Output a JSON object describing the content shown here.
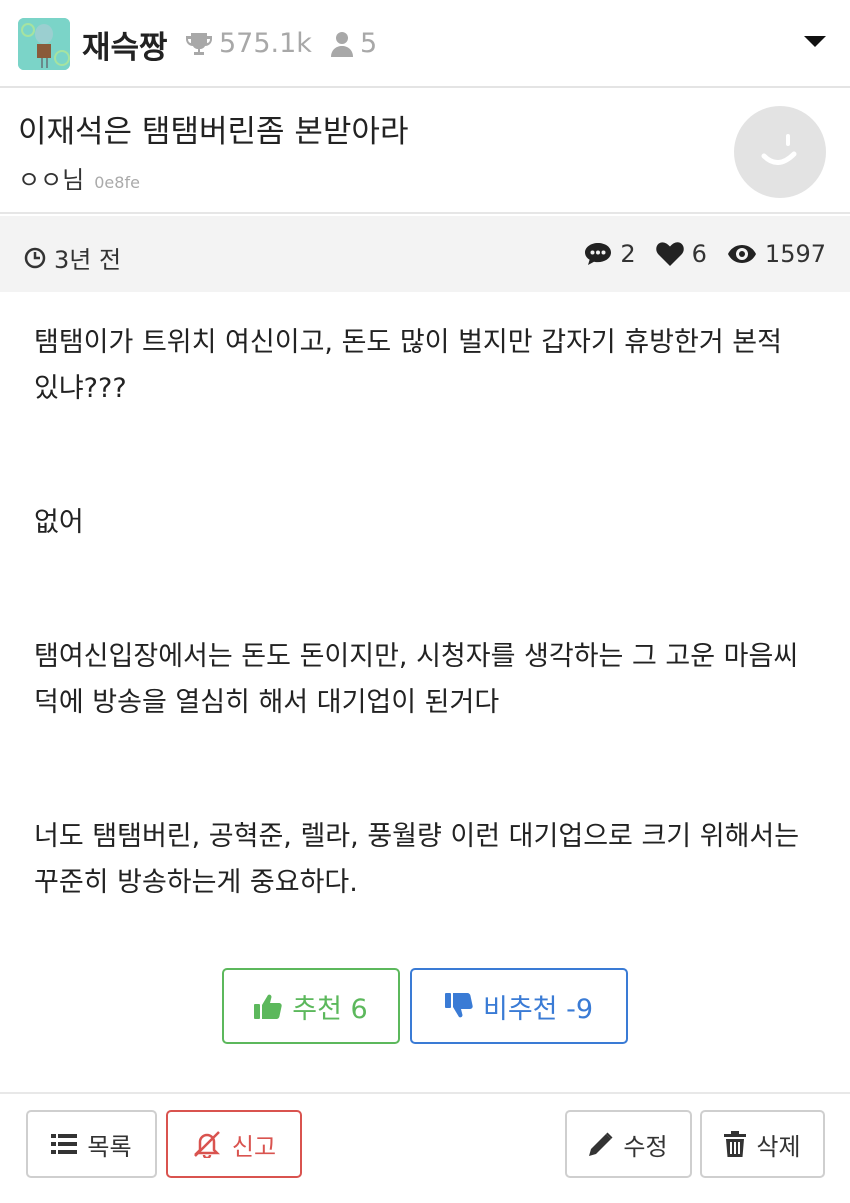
{
  "header": {
    "board_name": "재슥짱",
    "subscribers": "575.1k",
    "users": "5"
  },
  "post": {
    "title": "이재석은 탬탬버린좀 본받아라",
    "author": "ㅇㅇ님",
    "author_id": "0e8fe",
    "time": "3년 전",
    "comments": "2",
    "likes": "6",
    "views": "1597",
    "paragraphs": [
      "탬탬이가 트위치 여신이고, 돈도 많이 벌지만 갑자기 휴방한거 본적 있냐???",
      "없어",
      "탬여신입장에서는 돈도 돈이지만, 시청자를 생각하는 그 고운 마음씨덕에 방송을 열심히 해서 대기업이 된거다",
      "너도 탬탬버린, 공혁준, 렐라, 풍월량 이런 대기업으로 크기 위해서는 꾸준히 방송하는게 중요하다."
    ]
  },
  "votes": {
    "up_label": "추천 6",
    "down_label": "비추천 -9"
  },
  "actions": {
    "list_label": "목록",
    "report_label": "신고",
    "edit_label": "수정",
    "delete_label": "삭제"
  },
  "colors": {
    "upvote": "#5cb85c",
    "downvote": "#3a7bd5",
    "report": "#d9534f"
  }
}
